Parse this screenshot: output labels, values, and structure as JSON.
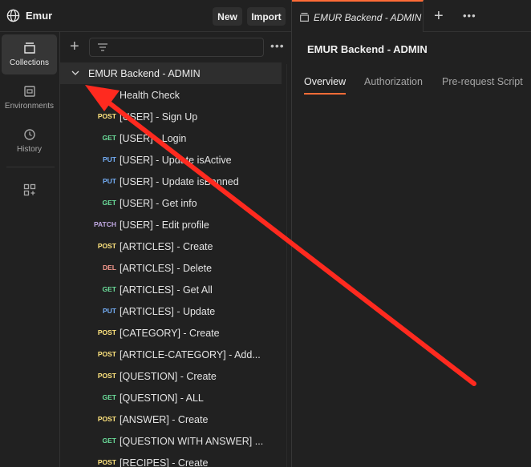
{
  "header": {
    "workspace_name": "Emur",
    "workspace_icon": "globe-icon",
    "new_label": "New",
    "import_label": "Import"
  },
  "rail": {
    "items": [
      {
        "label": "Collections",
        "icon": "collections-icon",
        "active": true
      },
      {
        "label": "Environments",
        "icon": "environments-icon",
        "active": false
      },
      {
        "label": "History",
        "icon": "history-icon",
        "active": false
      },
      {
        "label": "",
        "icon": "add-widgets-icon",
        "active": false
      }
    ]
  },
  "sidebar": {
    "collection_name": "EMUR Backend - ADMIN",
    "requests": [
      {
        "method": "GET",
        "name": "Health Check"
      },
      {
        "method": "POST",
        "name": "[USER] - Sign Up"
      },
      {
        "method": "GET",
        "name": "[USER] - Login"
      },
      {
        "method": "PUT",
        "name": "[USER] - Update isActive"
      },
      {
        "method": "PUT",
        "name": "[USER] - Update isBanned"
      },
      {
        "method": "GET",
        "name": "[USER] - Get info"
      },
      {
        "method": "PATCH",
        "name": "[USER] - Edit profile"
      },
      {
        "method": "POST",
        "name": "[ARTICLES] - Create"
      },
      {
        "method": "DEL",
        "name": "[ARTICLES] - Delete"
      },
      {
        "method": "GET",
        "name": "[ARTICLES] - Get All"
      },
      {
        "method": "PUT",
        "name": "[ARTICLES] - Update"
      },
      {
        "method": "POST",
        "name": "[CATEGORY] - Create"
      },
      {
        "method": "POST",
        "name": "[ARTICLE-CATEGORY] - Add..."
      },
      {
        "method": "POST",
        "name": "[QUESTION] - Create"
      },
      {
        "method": "GET",
        "name": "[QUESTION] - ALL"
      },
      {
        "method": "POST",
        "name": "[ANSWER] - Create"
      },
      {
        "method": "GET",
        "name": "[QUESTION WITH ANSWER] ..."
      },
      {
        "method": "POST",
        "name": "[RECIPES] - Create"
      }
    ]
  },
  "tab": {
    "name": "EMUR Backend - ADMIN"
  },
  "main": {
    "title": "EMUR Backend - ADMIN",
    "subtabs": [
      "Overview",
      "Authorization",
      "Pre-request Script"
    ]
  },
  "colors": {
    "accent": "#ff6c37",
    "get": "#6bdd9a",
    "post": "#ffe47e",
    "put": "#74aef6",
    "patch": "#c0a8e1",
    "del": "#f79a8e",
    "annotation_arrow": "#ff2a1f"
  }
}
